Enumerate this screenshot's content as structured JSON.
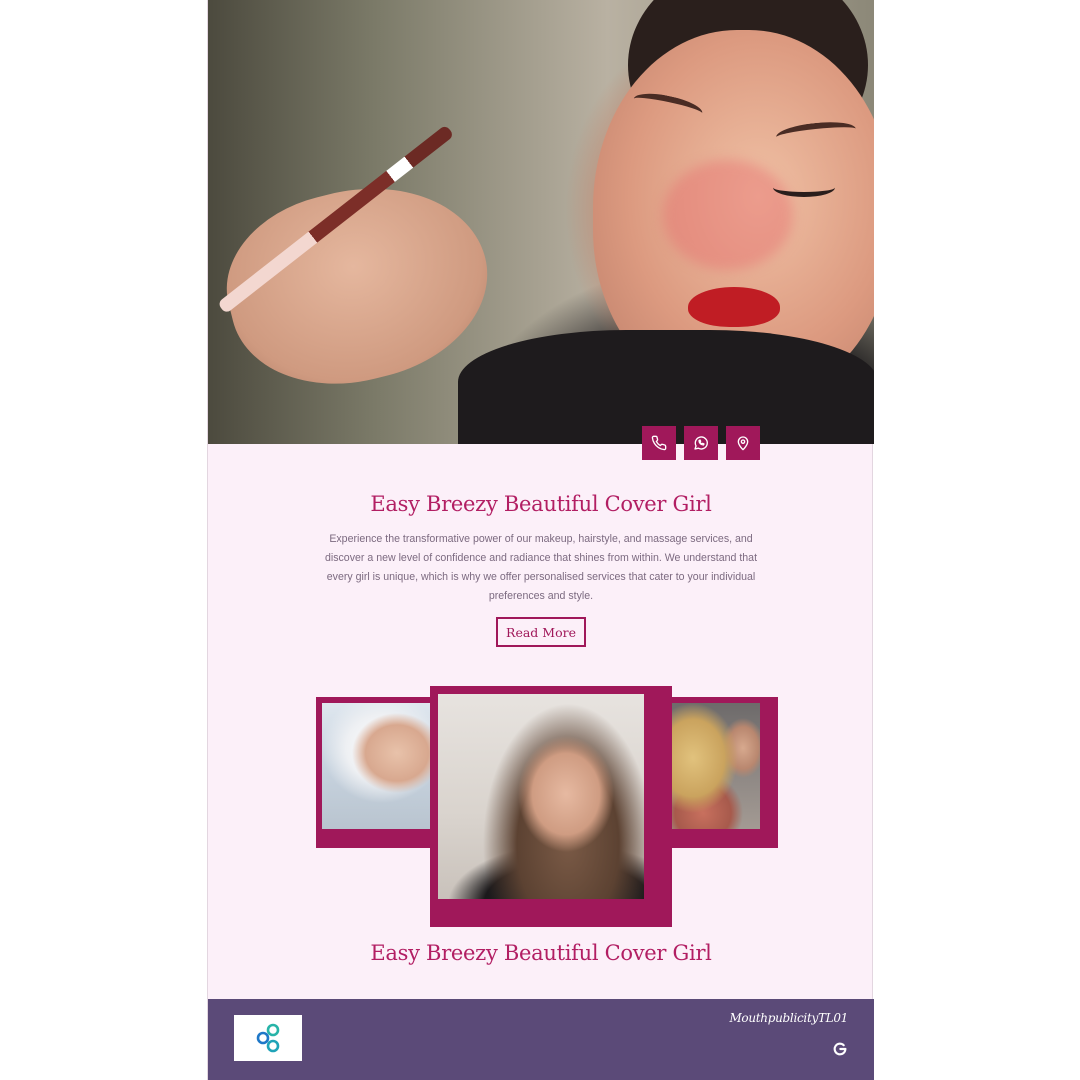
{
  "hero": {
    "image": "makeup-artist-applying-eyeshadow-photo"
  },
  "contact_buttons": [
    {
      "icon": "phone-icon"
    },
    {
      "icon": "whatsapp-icon"
    },
    {
      "icon": "location-pin-icon"
    }
  ],
  "intro": {
    "title": "Easy Breezy Beautiful Cover Girl",
    "description": "Experience the transformative power of our makeup, hairstyle, and massage services, and discover a new level of confidence and radiance that shines from within. We understand that every girl is unique, which is why we offer personalised services that cater to your individual preferences and style.",
    "read_more": "Read More"
  },
  "gallery": {
    "images": [
      "facial-treatment-photo",
      "hair-curling-photo",
      "makeup-session-photo"
    ],
    "title": "Easy Breezy Beautiful Cover Girl"
  },
  "footer": {
    "brand": "MouthpublicityTL01",
    "logo": "network-logo-icon",
    "social_icon": "google-icon"
  },
  "colors": {
    "accent": "#a0185a",
    "title": "#b21e63",
    "background": "#fcf0f9",
    "footer": "#5b4a78"
  }
}
